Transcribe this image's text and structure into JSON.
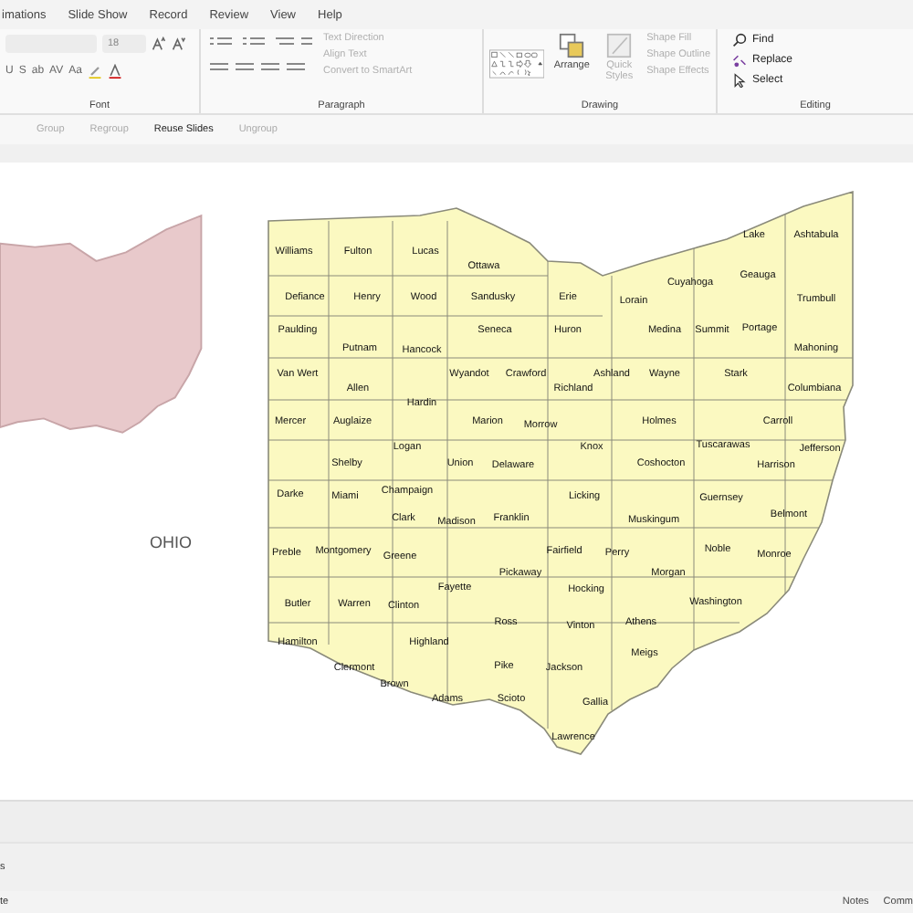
{
  "ribbon_tabs": [
    {
      "label": "imations"
    },
    {
      "label": "Slide Show"
    },
    {
      "label": "Record"
    },
    {
      "label": "Review"
    },
    {
      "label": "View"
    },
    {
      "label": "Help"
    }
  ],
  "font_group": {
    "label": "Font",
    "size": "18",
    "format_buttons": [
      "U",
      "S",
      "ab",
      "AV",
      "Aa"
    ]
  },
  "paragraph_group": {
    "label": "Paragraph",
    "commands": [
      {
        "label": "Text Direction",
        "disabled": true
      },
      {
        "label": "Align Text",
        "disabled": true
      },
      {
        "label": "Convert to SmartArt",
        "disabled": true
      }
    ]
  },
  "drawing_group": {
    "label": "Drawing",
    "arrange": "Arrange",
    "quick_styles": {
      "label": "Quick Styles",
      "disabled": true
    },
    "commands": [
      {
        "label": "Shape Fill",
        "disabled": true
      },
      {
        "label": "Shape Outline",
        "disabled": true
      },
      {
        "label": "Shape Effects",
        "disabled": true
      }
    ]
  },
  "editing_group": {
    "label": "Editing",
    "commands": [
      {
        "label": "Find",
        "disabled": false
      },
      {
        "label": "Replace",
        "disabled": false
      },
      {
        "label": "Select",
        "disabled": false
      }
    ]
  },
  "toolbar": [
    {
      "label": "Group",
      "disabled": true
    },
    {
      "label": "Regroup",
      "disabled": true
    },
    {
      "label": "Reuse Slides",
      "disabled": false
    },
    {
      "label": "Ungroup",
      "disabled": true
    }
  ],
  "slide": {
    "title": "OHIO",
    "counties": [
      "Lake",
      "Ashtabula",
      "Williams",
      "Fulton",
      "Lucas",
      "Ottawa",
      "Geauga",
      "Cuyahoga",
      "Defiance",
      "Henry",
      "Wood",
      "Sandusky",
      "Erie",
      "Lorain",
      "Trumbull",
      "Paulding",
      "Seneca",
      "Huron",
      "Medina",
      "Summit",
      "Portage",
      "Putnam",
      "Hancock",
      "Mahoning",
      "Van Wert",
      "Wyandot",
      "Crawford",
      "Ashland",
      "Wayne",
      "Stark",
      "Allen",
      "Richland",
      "Columbiana",
      "Hardin",
      "Mercer",
      "Auglaize",
      "Marion",
      "Morrow",
      "Holmes",
      "Carroll",
      "Logan",
      "Knox",
      "Tuscarawas",
      "Jefferson",
      "Shelby",
      "Union",
      "Delaware",
      "Coshocton",
      "Harrison",
      "Darke",
      "Miami",
      "Champaign",
      "Licking",
      "Guernsey",
      "Clark",
      "Madison",
      "Franklin",
      "Muskingum",
      "Belmont",
      "Preble",
      "Montgomery",
      "Greene",
      "Fairfield",
      "Perry",
      "Noble",
      "Monroe",
      "Pickaway",
      "Morgan",
      "Fayette",
      "Hocking",
      "Butler",
      "Warren",
      "Clinton",
      "Washington",
      "Ross",
      "Vinton",
      "Athens",
      "Hamilton",
      "Highland",
      "Meigs",
      "Clermont",
      "Pike",
      "Jackson",
      "Brown",
      "Adams",
      "Scioto",
      "Gallia",
      "Lawrence"
    ]
  },
  "thumbnail_pane": {
    "text": "s"
  },
  "status_bar": {
    "left": "te",
    "buttons": [
      "Notes",
      "Comm"
    ]
  }
}
